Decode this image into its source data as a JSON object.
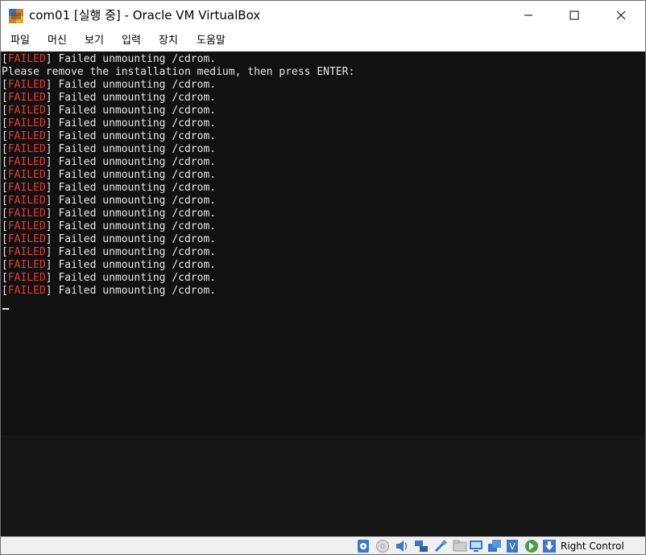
{
  "window": {
    "title": "com01 [실행 중] - Oracle VM VirtualBox"
  },
  "menu": [
    "파일",
    "머신",
    "보기",
    "입력",
    "장치",
    "도움말"
  ],
  "console": {
    "lines": [
      {
        "tag": "FAILED",
        "text": " Failed unmounting /cdrom."
      },
      {
        "tag": "",
        "text": "Please remove the installation medium, then press ENTER:"
      },
      {
        "tag": "FAILED",
        "text": " Failed unmounting /cdrom."
      },
      {
        "tag": "FAILED",
        "text": " Failed unmounting /cdrom."
      },
      {
        "tag": "FAILED",
        "text": " Failed unmounting /cdrom."
      },
      {
        "tag": "FAILED",
        "text": " Failed unmounting /cdrom."
      },
      {
        "tag": "FAILED",
        "text": " Failed unmounting /cdrom."
      },
      {
        "tag": "FAILED",
        "text": " Failed unmounting /cdrom."
      },
      {
        "tag": "FAILED",
        "text": " Failed unmounting /cdrom."
      },
      {
        "tag": "FAILED",
        "text": " Failed unmounting /cdrom."
      },
      {
        "tag": "FAILED",
        "text": " Failed unmounting /cdrom."
      },
      {
        "tag": "FAILED",
        "text": " Failed unmounting /cdrom."
      },
      {
        "tag": "FAILED",
        "text": " Failed unmounting /cdrom."
      },
      {
        "tag": "FAILED",
        "text": " Failed unmounting /cdrom."
      },
      {
        "tag": "FAILED",
        "text": " Failed unmounting /cdrom."
      },
      {
        "tag": "FAILED",
        "text": " Failed unmounting /cdrom."
      },
      {
        "tag": "FAILED",
        "text": " Failed unmounting /cdrom."
      },
      {
        "tag": "FAILED",
        "text": " Failed unmounting /cdrom."
      },
      {
        "tag": "FAILED",
        "text": " Failed unmounting /cdrom."
      }
    ],
    "colors": {
      "failed": "#e23b3b",
      "text": "#e6e6e6",
      "background": "#111111"
    }
  },
  "statusbar": {
    "icons": [
      "hard-disk-icon",
      "optical-drive-icon",
      "audio-icon",
      "network-icon",
      "usb-icon",
      "shared-folders-icon",
      "display-icon",
      "video-capture-icon",
      "virtualization-icon",
      "mouse-integration-icon",
      "keyboard-capture-icon"
    ],
    "host_key_label": "Right Control"
  }
}
